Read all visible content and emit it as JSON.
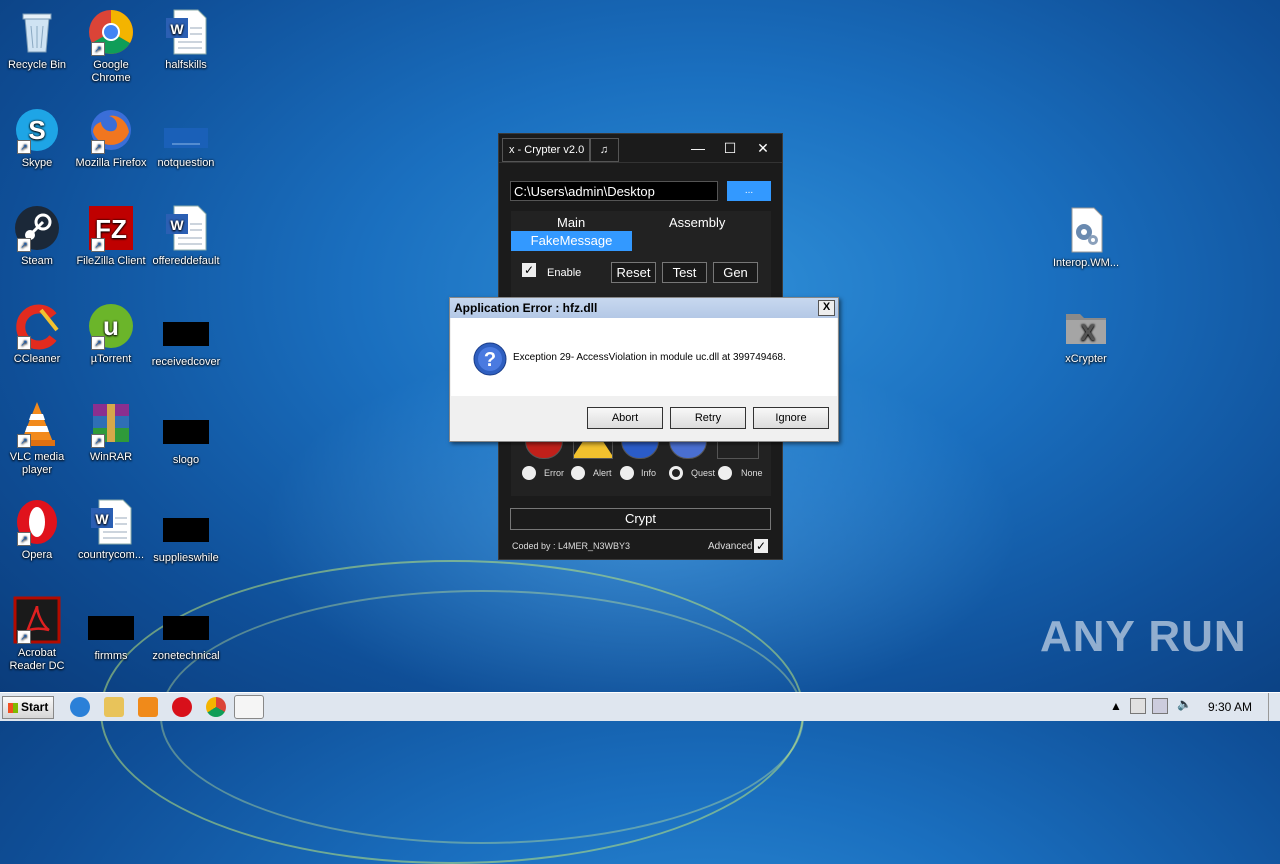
{
  "desktop": {
    "icons": [
      {
        "label": "Recycle Bin"
      },
      {
        "label": "Google Chrome"
      },
      {
        "label": "halfskills"
      },
      {
        "label": "Skype"
      },
      {
        "label": "Mozilla Firefox"
      },
      {
        "label": "notquestion"
      },
      {
        "label": "Steam"
      },
      {
        "label": "FileZilla Client"
      },
      {
        "label": "offereddefault"
      },
      {
        "label": "CCleaner"
      },
      {
        "label": "µTorrent"
      },
      {
        "label": "receivedcover"
      },
      {
        "label": "VLC media player"
      },
      {
        "label": "WinRAR"
      },
      {
        "label": "slogo"
      },
      {
        "label": "Opera"
      },
      {
        "label": "countrycom..."
      },
      {
        "label": "supplieswhile"
      },
      {
        "label": "Acrobat Reader DC"
      },
      {
        "label": "firmms"
      },
      {
        "label": "zonetechnical"
      },
      {
        "label": "Interop.WM..."
      },
      {
        "label": "xCrypter"
      }
    ]
  },
  "crypter": {
    "title": "x - Crypter v2.0",
    "music_tab": "♫",
    "minimize": "—",
    "maximize": "☐",
    "close": "✕",
    "path_value": "C:\\Users\\admin\\Desktop",
    "browse_label": "...",
    "tabs": {
      "main": "Main",
      "assembly": "Assembly",
      "fake_message": "FakeMessage"
    },
    "enable_label": "Enable",
    "reset_label": "Reset",
    "test_label": "Test",
    "gen_label": "Gen",
    "radios": [
      {
        "label": "Error"
      },
      {
        "label": "Alert"
      },
      {
        "label": "Info"
      },
      {
        "label": "Quest"
      },
      {
        "label": "None"
      }
    ],
    "crypt_label": "Crypt",
    "coded_by": "Coded by : L4MER_N3WBY3",
    "advanced_label": "Advanced"
  },
  "dialog": {
    "title": "Application Error : hfz.dll",
    "message": "Exception 29- AccessViolation in module uc.dll at 399749468.",
    "close": "X",
    "abort": "Abort",
    "retry": "Retry",
    "ignore": "Ignore"
  },
  "taskbar": {
    "start_label": "Start",
    "time": "9:30 AM"
  },
  "watermark": "ANY RUN",
  "colors": {
    "accent": "#3399ff",
    "desktop": "#1a6fbf"
  }
}
